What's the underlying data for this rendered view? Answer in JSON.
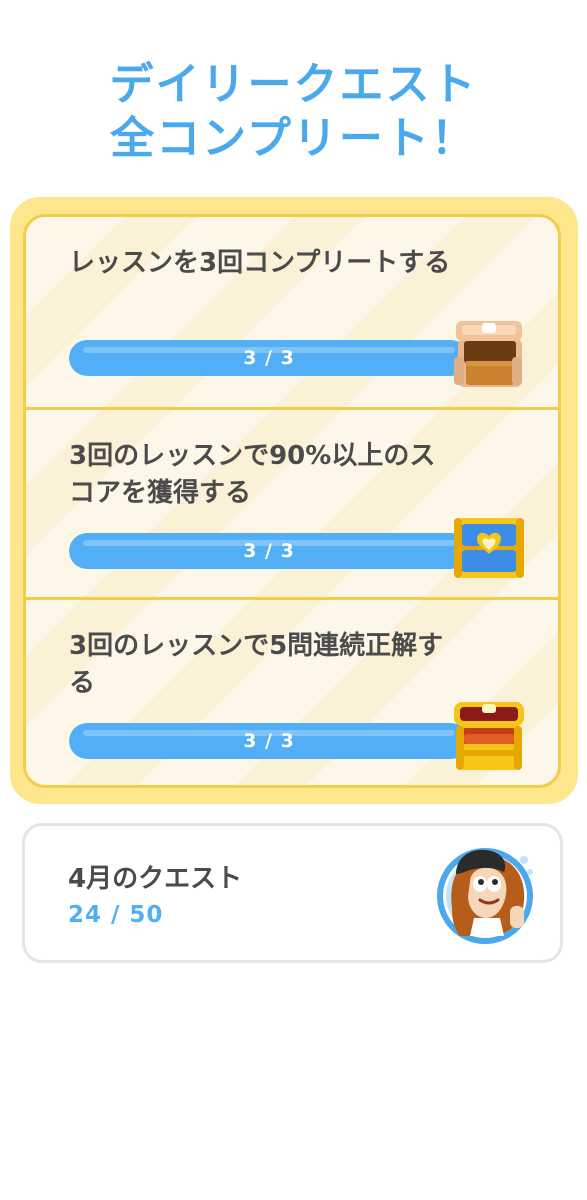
{
  "header": {
    "title_line1": "デイリークエスト",
    "title_line2": "全コンプリート！"
  },
  "quests": [
    {
      "title": "レッスンを3回コンプリートする",
      "progress_label": "3 / 3",
      "progress_fraction": 1.0,
      "reward_icon": "open-brown-chest-icon"
    },
    {
      "title": "3回のレッスンで90%以上のスコアを獲得する",
      "progress_label": "3 / 3",
      "progress_fraction": 1.0,
      "reward_icon": "blue-chest-icon"
    },
    {
      "title": "3回のレッスンで5問連続正解する",
      "progress_label": "3 / 3",
      "progress_fraction": 1.0,
      "reward_icon": "open-gold-chest-icon"
    }
  ],
  "monthly": {
    "title": "4月のクエスト",
    "progress": "24 / 50",
    "avatar_icon": "character-badge-icon"
  },
  "colors": {
    "accent_blue": "#52aef5",
    "title_blue": "#4aa8ec",
    "gold_border": "#f2cd4b",
    "gold_frame": "#fde68c",
    "text_dark": "#4b4b4b"
  }
}
